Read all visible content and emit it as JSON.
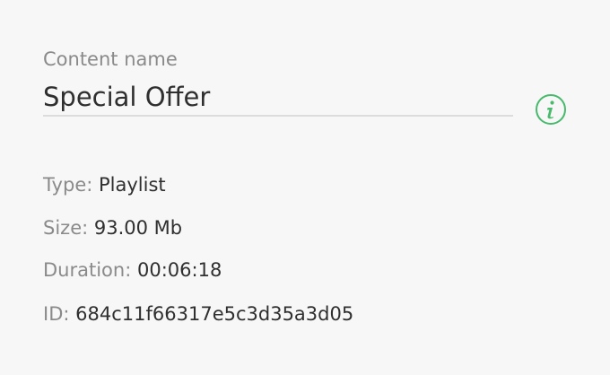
{
  "content": {
    "name_label": "Content name",
    "name_value": "Special Offer"
  },
  "info_icon": {
    "icon": "info-icon",
    "color": "#48b96d"
  },
  "meta": {
    "type": {
      "label": "Type:",
      "value": "Playlist"
    },
    "size": {
      "label": "Size:",
      "value": "93.00 Mb"
    },
    "duration": {
      "label": "Duration:",
      "value": "00:06:18"
    },
    "id": {
      "label": "ID:",
      "value": "684c11f66317e5c3d35a3d05"
    }
  }
}
